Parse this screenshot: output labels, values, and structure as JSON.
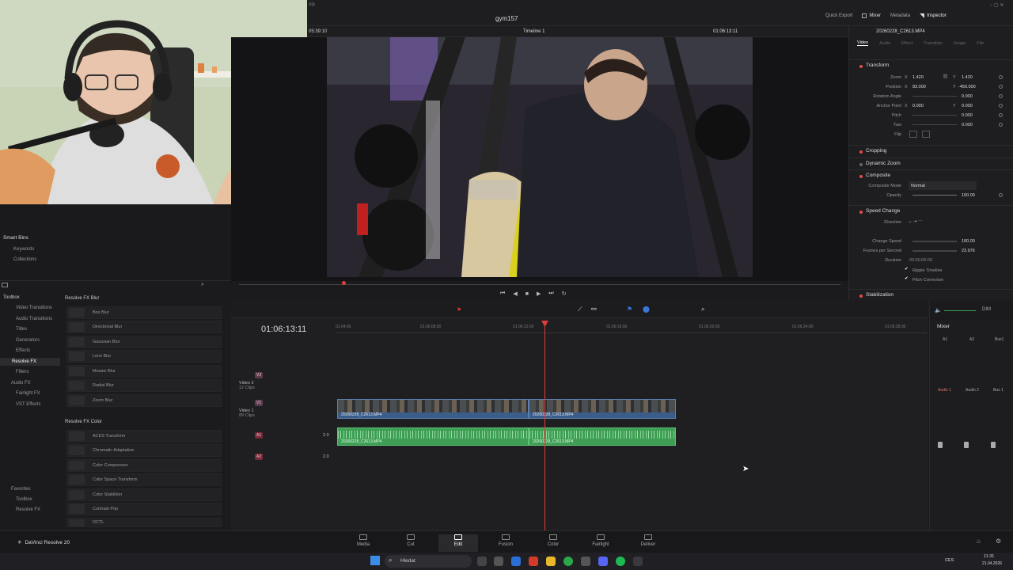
{
  "app": {
    "project_name": "gym157",
    "source_timecode": "05:39:10",
    "timeline_name": "Timeline 1",
    "record_timecode": "01:06:13:11",
    "clip_name": "20260228_C2613.MP4",
    "menu_tail": "elp"
  },
  "toolbar": {
    "quick_export": "Quick Export",
    "mixer": "Mixer",
    "metadata": "Metadata",
    "inspector": "Inspector"
  },
  "inspector": {
    "tabs": [
      "Video",
      "Audio",
      "Effect",
      "Transition",
      "Image",
      "File"
    ],
    "transform": {
      "title": "Transform",
      "zoom_label": "Zoom",
      "zoom_x": "1.420",
      "zoom_y": "1.420",
      "position_label": "Position",
      "pos_x": "83.000",
      "pos_y": "-450.000",
      "rotation_label": "Rotation Angle",
      "rotation": "0.000",
      "anchor_label": "Anchor Point",
      "anchor_x": "0.000",
      "anchor_y": "0.000",
      "pitch_label": "Pitch",
      "pitch": "0.000",
      "yaw_label": "Yaw",
      "yaw": "0.000",
      "flip_label": "Flip",
      "axis_x": "X",
      "axis_y": "Y"
    },
    "cropping": "Cropping",
    "dynamic_zoom": "Dynamic Zoom",
    "composite": {
      "title": "Composite",
      "mode_label": "Composite Mode",
      "mode": "Normal",
      "opacity_label": "Opacity",
      "opacity": "100.00"
    },
    "speed": {
      "title": "Speed Change",
      "direction_label": "Direction",
      "speed_label": "Change Speed",
      "speed": "100.00",
      "fps_label": "Frames per Second",
      "fps": "23.976",
      "duration_label": "Duration",
      "duration": "00:00:06:09",
      "ripple": "Ripple Timeline",
      "pitch_corr": "Pitch Correction"
    },
    "stabilization": "Stabilization"
  },
  "smart_bins": {
    "title": "Smart Bins",
    "items": [
      "Keywords",
      "Collections"
    ]
  },
  "toolbox": {
    "tree": [
      "Toolbox",
      "Video Transitions",
      "Audio Transitions",
      "Titles",
      "Generators",
      "Effects",
      "Resolve FX",
      "Filters",
      "Audio FX",
      "Fairlight FX",
      "VST Effects"
    ],
    "favorites": [
      "Favorites",
      "Toolbox",
      "Resolve FX"
    ],
    "blur_group": "Resolve FX Blur",
    "blur_items": [
      "Box Blur",
      "Directional Blur",
      "Gaussian Blur",
      "Lens Blur",
      "Mosaic Blur",
      "Radial Blur",
      "Zoom Blur"
    ],
    "color_group": "Resolve FX Color",
    "color_items": [
      "ACES Transform",
      "Chromatic Adaptation",
      "Color Compressor",
      "Color Space Transform",
      "Color Stabilizer",
      "Contrast Pop",
      "DCTL"
    ]
  },
  "timeline": {
    "timecode": "01:06:13:11",
    "ruler": [
      "01:04:00",
      "01:06:08:00",
      "01:06:12:00",
      "01:06:16:00",
      "01:06:20:00",
      "01:06:24:00",
      "01:06:28:00"
    ],
    "tracks": {
      "v2": {
        "badge": "V2",
        "name": "Video 2",
        "count": "12 Clips"
      },
      "v1": {
        "badge": "V1",
        "name": "Video 1",
        "count": "89 Clips"
      },
      "a1": {
        "badge": "A1",
        "ch": "2.0"
      },
      "a2": {
        "badge": "A2",
        "ch": "2.0"
      }
    },
    "clip1": "20260228_C2613.MP4",
    "clip2": "20260228_C2613.MP4",
    "aclip1": "20260228_C2613.MP4",
    "aclip2": "20260228_C2613.MP4"
  },
  "mixer": {
    "title": "Mixer",
    "strips": [
      "A1",
      "A2",
      "Bus1"
    ],
    "names": [
      "Audio 1",
      "Audio 2",
      "Bus 1"
    ],
    "dim": "DIM"
  },
  "pages": [
    "Media",
    "Cut",
    "Edit",
    "Fusion",
    "Color",
    "Fairlight",
    "Deliver"
  ],
  "brand": "DaVinci Resolve 20",
  "taskbar": {
    "search": "Hledat",
    "lang": "CES",
    "time": "11:31",
    "date": "21.04.2026"
  },
  "colors": {
    "accent_red": "#e64b4b",
    "video_clip": "#3b5d8a",
    "audio_clip": "#3e9e54",
    "playhead": "#e23b3b"
  }
}
